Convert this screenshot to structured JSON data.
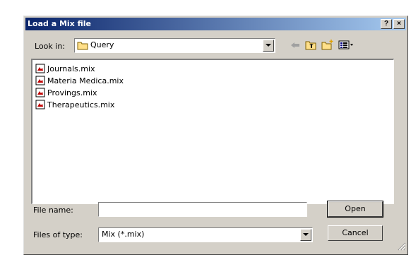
{
  "dialog": {
    "title": "Load a Mix file",
    "help_label": "?",
    "close_label": "×"
  },
  "lookin": {
    "label": "Look in:",
    "value": "Query"
  },
  "toolbar": {
    "icons": [
      "back-arrow-icon",
      "up-folder-icon",
      "new-folder-icon",
      "view-menu-icon"
    ]
  },
  "files": [
    {
      "name": "Journals.mix"
    },
    {
      "name": "Materia Medica.mix"
    },
    {
      "name": "Provings.mix"
    },
    {
      "name": "Therapeutics.mix"
    }
  ],
  "filename": {
    "label": "File name:",
    "value": ""
  },
  "filetype": {
    "label": "Files of type:",
    "value": "Mix (*.mix)"
  },
  "buttons": {
    "open": "Open",
    "cancel": "Cancel"
  },
  "colors": {
    "title_start": "#0a246a",
    "title_end": "#a6caf0",
    "face": "#d4d0c8"
  }
}
